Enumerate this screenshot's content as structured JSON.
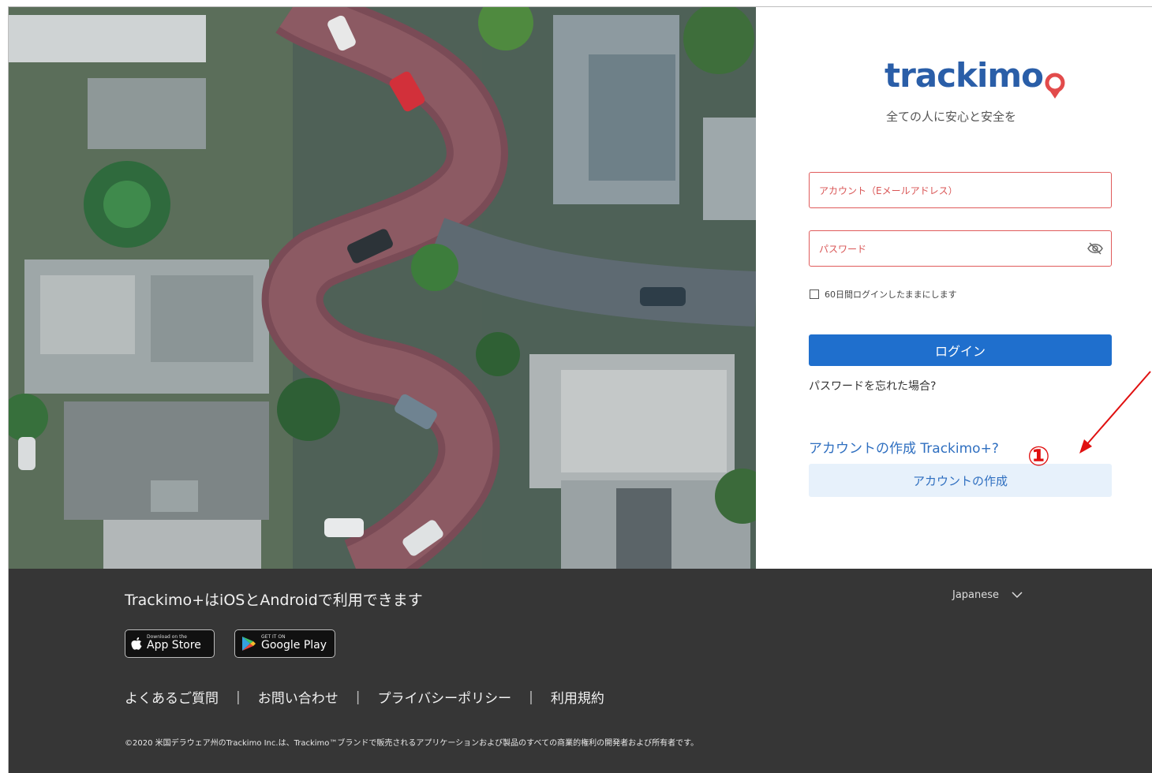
{
  "brand": {
    "logo_text": "trackimo",
    "tagline": "全ての人に安心と安全を",
    "color": "#2a5ea8",
    "pin_color": "#e24b4b"
  },
  "login": {
    "email_placeholder": "アカウント（Eメールアドレス）",
    "password_placeholder": "パスワード",
    "password_toggle_icon": "eye-off-icon",
    "remember_label": "60日間ログインしたままにします",
    "remember_checked": false,
    "login_button": "ログイン",
    "forgot_link": "パスワードを忘れた場合?",
    "create_prompt": "アカウントの作成 Trackimo+?",
    "create_button": "アカウントの作成",
    "annotation_marker": "①",
    "accent": "#1f6fcd"
  },
  "footer": {
    "availability": "Trackimo+はiOSとAndroidで利用できます",
    "language": "Japanese",
    "app_store": {
      "small": "Download on the",
      "big": "App Store"
    },
    "google_play": {
      "small": "GET IT ON",
      "big": "Google Play"
    },
    "links": [
      "よくあるご質問",
      "お問い合わせ",
      "プライバシーポリシー",
      "利用規約"
    ],
    "separator": "|",
    "copyright": "©2020 米国デラウェア州のTrackimo Inc.は、Trackimo™ブランドで販売されるアプリケーションおよび製品のすべての商業的権利の開発者および所有者です。",
    "background": "#363636"
  }
}
